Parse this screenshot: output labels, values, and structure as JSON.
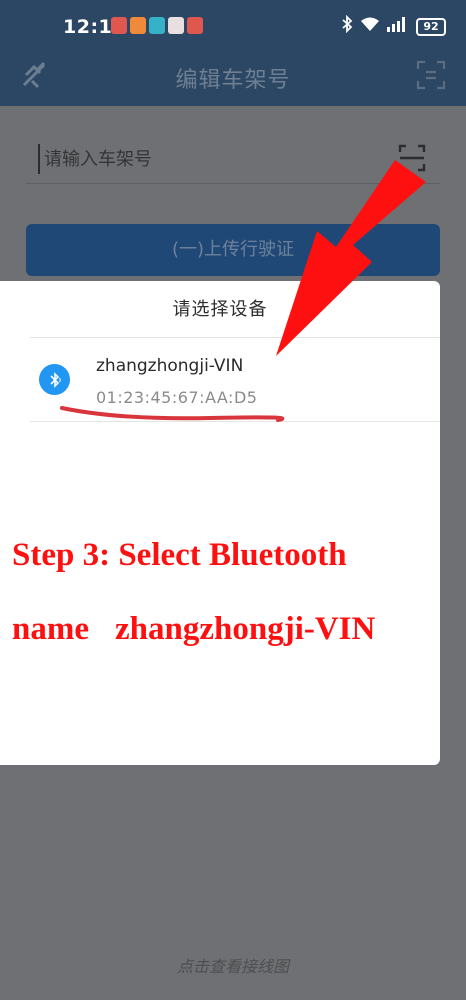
{
  "status_bar": {
    "time": "12:13",
    "battery": "92",
    "notification_icons": [
      "red-app-icon",
      "orange-app-icon",
      "teal-app-icon",
      "white-app-icon",
      "red-app-icon"
    ],
    "system_icons": [
      "bluetooth-icon",
      "wifi-icon",
      "signal-icon",
      "battery-icon"
    ]
  },
  "app_bar": {
    "title": "编辑车架号",
    "left_icon": "bluetooth-off-icon",
    "right_icon": "scan-icon"
  },
  "form": {
    "vin_placeholder": "请输入车架号",
    "vin_value": "",
    "upload_button_label": "(一)上传行驶证"
  },
  "dialog": {
    "title": "请选择设备",
    "devices": [
      {
        "name": "zhangzhongji-VIN",
        "mac": "01:23:45:67:AA:D5",
        "icon": "bluetooth-icon"
      }
    ]
  },
  "annotation": {
    "line1": "Step 3: Select Bluetooth",
    "line2_label": "name",
    "line2_value": "zhangzhongji-VIN",
    "color": "#ff1010"
  },
  "footer": {
    "wiring_link": "点击查看接线图"
  },
  "colors": {
    "navy": "#2c4763",
    "button": "#1f4876",
    "overlay": "#6e7073",
    "bluetooth": "#2196f3",
    "annotation_red": "#ff1010"
  }
}
